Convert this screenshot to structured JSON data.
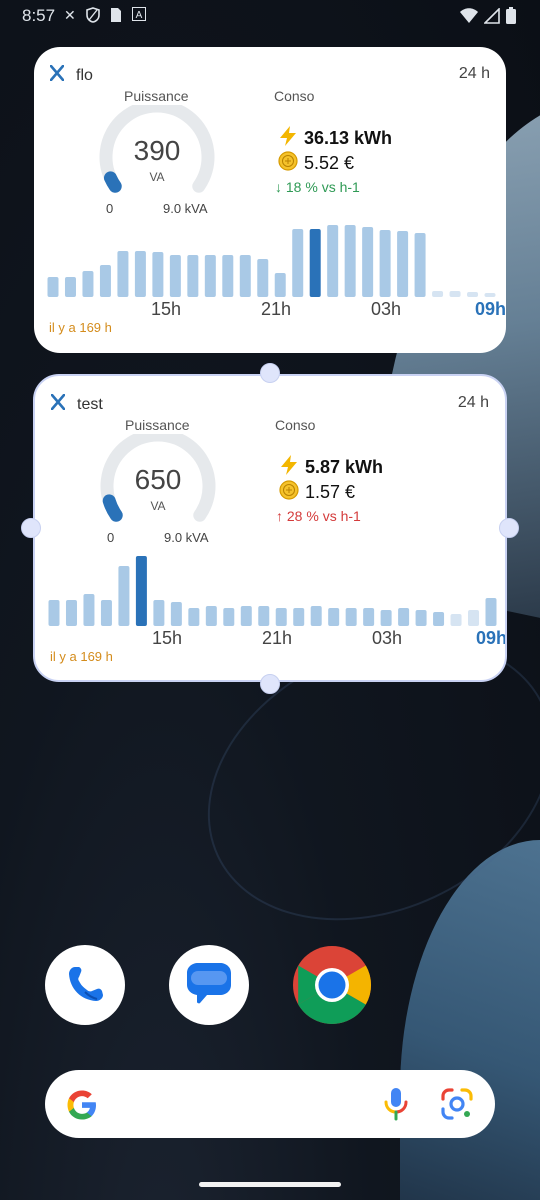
{
  "statusbar": {
    "time": "8:57",
    "icons": [
      "x-logo-icon",
      "shield-icon",
      "sim-icon",
      "font-icon"
    ],
    "right_icons": [
      "wifi-icon",
      "signal-icon",
      "battery-icon"
    ]
  },
  "widgets": [
    {
      "name": "flo",
      "range": "24 h",
      "puissance_label": "Puissance",
      "conso_label": "Conso",
      "gauge_value": "390",
      "gauge_value_num": 390,
      "gauge_unit": "VA",
      "gauge_min": "0",
      "gauge_max": "9.0 kVA",
      "gauge_max_num": 9000,
      "energy": "36.13 kWh",
      "cost": "5.52 €",
      "delta": "↓ 18 % vs h-1",
      "delta_color": "#2f9a55",
      "ago": "il y a 169 h",
      "ticks": [
        "15h",
        "21h",
        "03h",
        "09h"
      ],
      "bars": [
        20,
        20,
        26,
        32,
        46,
        46,
        45,
        42,
        42,
        42,
        42,
        42,
        38,
        24,
        68,
        68,
        72,
        72,
        70,
        67,
        66,
        64,
        6,
        6,
        5,
        4
      ],
      "highlight_index": 15,
      "faded_from": 22
    },
    {
      "name": "test",
      "range": "24 h",
      "puissance_label": "Puissance",
      "conso_label": "Conso",
      "gauge_value": "650",
      "gauge_value_num": 650,
      "gauge_unit": "VA",
      "gauge_min": "0",
      "gauge_max": "9.0 kVA",
      "gauge_max_num": 9000,
      "energy": "5.87 kWh",
      "cost": "1.57 €",
      "delta": "↑ 28 % vs h-1",
      "delta_color": "#d43b3b",
      "ago": "il y a 169 h",
      "ticks": [
        "15h",
        "21h",
        "03h",
        "09h"
      ],
      "bars": [
        26,
        26,
        32,
        26,
        60,
        70,
        26,
        24,
        18,
        20,
        18,
        20,
        20,
        18,
        18,
        20,
        18,
        18,
        18,
        16,
        18,
        16,
        14,
        12,
        16,
        28
      ],
      "highlight_index": 5,
      "faded_from": 23
    }
  ],
  "colors": {
    "bar": "#a9c9e6",
    "bar_highlight": "#2a72b8",
    "bar_faded": "#d6e4f2",
    "gauge_track": "#e6e9ec",
    "gauge_fill": "#2a72b8",
    "tick_current": "#2a72b8"
  },
  "dock": {
    "apps": [
      "phone-icon",
      "messages-icon",
      "chrome-icon"
    ]
  },
  "search": {
    "icons": [
      "google-g-icon",
      "mic-icon",
      "lens-icon"
    ]
  }
}
